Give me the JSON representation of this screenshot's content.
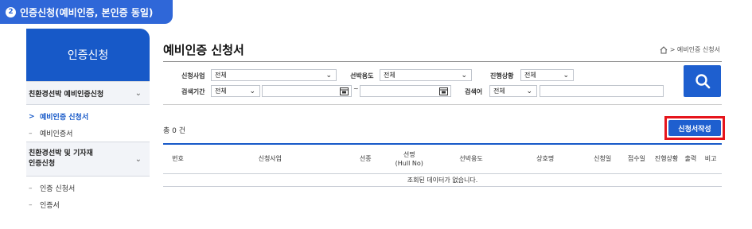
{
  "banner": {
    "number": "2",
    "text": "인증신청(예비인증, 본인증 동일)"
  },
  "sidebar": {
    "title": "인증신청",
    "groups": [
      {
        "label": "친환경선박 예비인증신청",
        "items": [
          "예비인증 신청서",
          "예비인증서"
        ]
      },
      {
        "label_line1": "친환경선박 및 기자재",
        "label_line2": "인증신청",
        "items": [
          "인증 신청서",
          "인증서"
        ]
      }
    ],
    "active_marker": ">",
    "item_marker": "–",
    "chevron": "⌄"
  },
  "page": {
    "title": "예비인증 신청서",
    "breadcrumb": "> 예비인증 신청서"
  },
  "search": {
    "business_label": "신청사업",
    "business_value": "전체",
    "usage_label": "선박용도",
    "usage_value": "전체",
    "status_label": "진행상황",
    "status_value": "전체",
    "period_label": "검색기간",
    "period_value": "전체",
    "date_tilde": "~",
    "keyword_label": "검색어",
    "keyword_value": "전체"
  },
  "list": {
    "total": "총 0 건",
    "write_button": "신청서작성",
    "columns": [
      "번호",
      "신청사업",
      "선종",
      "선명",
      "(Hull No)",
      "선박용도",
      "상호명",
      "신청일",
      "접수일",
      "진행상황",
      "출력",
      "비고"
    ],
    "empty_message": "조회된 데이터가 없습니다."
  },
  "colors": {
    "primary": "#1759c8",
    "button": "#1e5fcf",
    "highlight": "#e6151c",
    "banner": "#2f67d8"
  }
}
